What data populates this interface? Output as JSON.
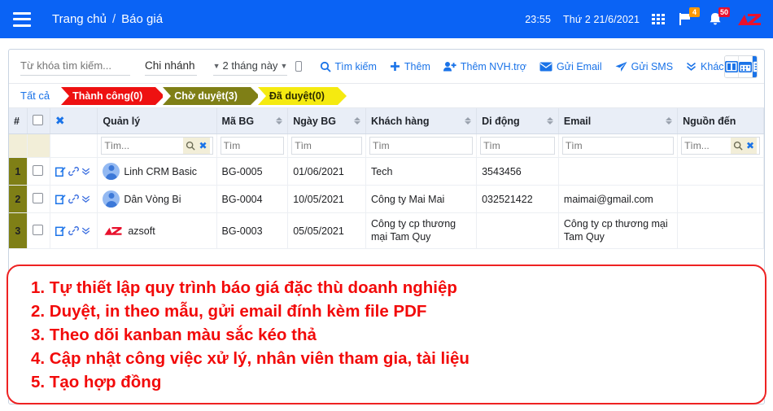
{
  "topbar": {
    "menu_icon": "hamburger-icon",
    "breadcrumb": {
      "home": "Trang chủ",
      "separator": "/",
      "current": "Báo giá"
    },
    "time": "23:55",
    "date": "Thứ 2 21/6/2021",
    "apps_icon": "grid-apps-icon",
    "flag_icon": "flag-icon",
    "flag_badge": "4",
    "bell_icon": "bell-icon",
    "bell_badge": "50",
    "brand_logo": "azsoft-logo-icon",
    "bg_color": "#0a63f5"
  },
  "toolbar": {
    "search_placeholder": "Từ khóa tìm kiếm...",
    "search_value": "",
    "branch_label": "Chi nhánh",
    "date_range": "2 tháng này",
    "select_all_checkbox": "toolbar-checkbox",
    "actions": [
      {
        "label": "Tìm kiếm",
        "icon": "search-icon"
      },
      {
        "label": "Thêm",
        "icon": "plus-icon"
      },
      {
        "label": "Thêm NVH.trợ",
        "icon": "user-plus-icon"
      },
      {
        "label": "Gửi Email",
        "icon": "envelope-icon"
      },
      {
        "label": "Gửi SMS",
        "icon": "paper-plane-icon"
      },
      {
        "label": "Khác",
        "icon": "chevron-double-down-icon"
      }
    ],
    "views": [
      {
        "name": "columns-view",
        "icon": "columns-icon",
        "active": false
      },
      {
        "name": "calendar-view",
        "icon": "calendar-icon",
        "active": false
      },
      {
        "name": "list-view",
        "icon": "list-icon",
        "active": true
      }
    ]
  },
  "status_tabs": {
    "all_label": "Tất cả",
    "items": [
      {
        "label": "Thành công(0)",
        "color": "#ee1111"
      },
      {
        "label": "Chờ duyệt(3)",
        "color": "#7f7f16"
      },
      {
        "label": "Đã duyệt(0)",
        "color": "#f5ea10"
      }
    ]
  },
  "table": {
    "headers": {
      "num": "#",
      "manager": "Quản lý",
      "code": "Mã BG",
      "date": "Ngày BG",
      "customer": "Khách hàng",
      "mobile": "Di động",
      "email": "Email",
      "source": "Nguồn đến"
    },
    "filters": {
      "manager": "Tìm...",
      "code": "Tìm",
      "date": "Tìm",
      "customer": "Tìm",
      "mobile": "Tìm",
      "email": "Tìm",
      "source": "Tìm...",
      "search_icon": "search-icon",
      "clear_icon": "clear-x-icon"
    },
    "rows": [
      {
        "num": "1",
        "manager": "Linh CRM Basic",
        "manager_icon": "avatar-icon",
        "code": "BG-0005",
        "date": "01/06/2021",
        "customer": "Tech",
        "mobile": "3543456",
        "email": "",
        "source": ""
      },
      {
        "num": "2",
        "manager": "Dân Vòng Bi",
        "manager_icon": "avatar-icon",
        "code": "BG-0004",
        "date": "10/05/2021",
        "customer": "Công ty Mai Mai",
        "mobile": "032521422",
        "email": "maimai@gmail.com",
        "source": ""
      },
      {
        "num": "3",
        "manager": "azsoft",
        "manager_icon": "azsoft-logo-icon",
        "code": "BG-0003",
        "date": "05/05/2021",
        "customer": "Công ty cp thương mại Tam Quy",
        "mobile": "",
        "email": "Công ty cp thương mại Tam Quy",
        "source": ""
      }
    ],
    "row_action_icons": [
      "edit-icon",
      "link-icon",
      "chevron-double-down-icon"
    ]
  },
  "overlay": {
    "border_color": "#ee2222",
    "text_color": "#f20a0a",
    "lines": [
      "1. Tự thiết lập quy trình báo giá đặc thù doanh nghiệp",
      "2. Duyệt, in theo mẫu, gửi email đính kèm file PDF",
      "3. Theo dõi kanban màu sắc kéo thả",
      "4. Cập nhật công việc xử lý, nhân viên tham gia, tài liệu",
      "5. Tạo hợp đồng"
    ]
  }
}
